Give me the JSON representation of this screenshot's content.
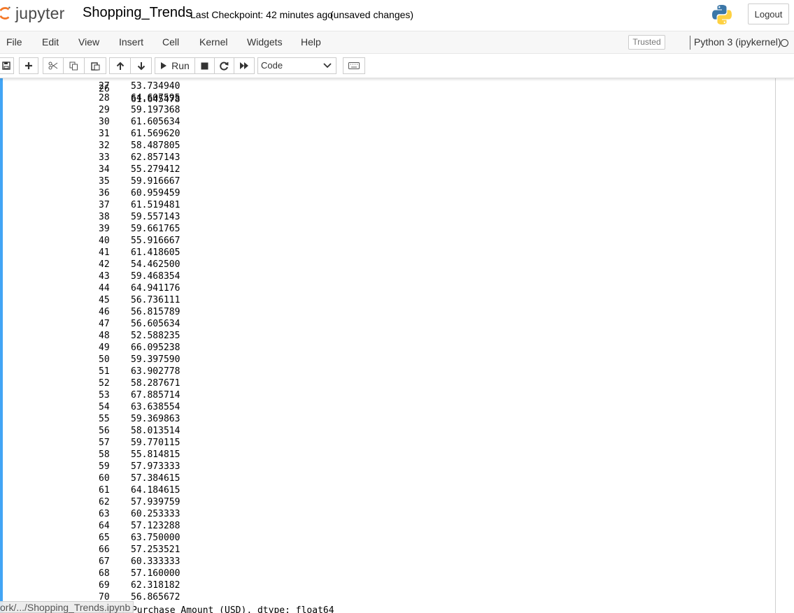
{
  "header": {
    "logo_text": "jupyter",
    "notebook_name": "Shopping_Trends",
    "checkpoint": "Last Checkpoint: 42 minutes ago",
    "autosave": "(unsaved changes)",
    "logout_label": "Logout"
  },
  "menubar": {
    "items": [
      "File",
      "Edit",
      "View",
      "Insert",
      "Cell",
      "Kernel",
      "Widgets",
      "Help"
    ],
    "trusted_label": "Trusted",
    "kernel_name": "Python 3 (ipykernel)"
  },
  "toolbar": {
    "run_label": "Run",
    "cell_type": "Code"
  },
  "output": {
    "partial_top": {
      "index": "26",
      "value": "61.645478"
    },
    "rows": [
      {
        "index": "27",
        "value": "53.734940"
      },
      {
        "index": "28",
        "value": "64.607595"
      },
      {
        "index": "29",
        "value": "59.197368"
      },
      {
        "index": "30",
        "value": "61.605634"
      },
      {
        "index": "31",
        "value": "61.569620"
      },
      {
        "index": "32",
        "value": "58.487805"
      },
      {
        "index": "33",
        "value": "62.857143"
      },
      {
        "index": "34",
        "value": "55.279412"
      },
      {
        "index": "35",
        "value": "59.916667"
      },
      {
        "index": "36",
        "value": "60.959459"
      },
      {
        "index": "37",
        "value": "61.519481"
      },
      {
        "index": "38",
        "value": "59.557143"
      },
      {
        "index": "39",
        "value": "59.661765"
      },
      {
        "index": "40",
        "value": "55.916667"
      },
      {
        "index": "41",
        "value": "61.418605"
      },
      {
        "index": "42",
        "value": "54.462500"
      },
      {
        "index": "43",
        "value": "59.468354"
      },
      {
        "index": "44",
        "value": "64.941176"
      },
      {
        "index": "45",
        "value": "56.736111"
      },
      {
        "index": "46",
        "value": "56.815789"
      },
      {
        "index": "47",
        "value": "56.605634"
      },
      {
        "index": "48",
        "value": "52.588235"
      },
      {
        "index": "49",
        "value": "66.095238"
      },
      {
        "index": "50",
        "value": "59.397590"
      },
      {
        "index": "51",
        "value": "63.902778"
      },
      {
        "index": "52",
        "value": "58.287671"
      },
      {
        "index": "53",
        "value": "67.885714"
      },
      {
        "index": "54",
        "value": "63.638554"
      },
      {
        "index": "55",
        "value": "59.369863"
      },
      {
        "index": "56",
        "value": "58.013514"
      },
      {
        "index": "57",
        "value": "59.770115"
      },
      {
        "index": "58",
        "value": "55.814815"
      },
      {
        "index": "59",
        "value": "57.973333"
      },
      {
        "index": "60",
        "value": "57.384615"
      },
      {
        "index": "61",
        "value": "64.184615"
      },
      {
        "index": "62",
        "value": "57.939759"
      },
      {
        "index": "63",
        "value": "60.253333"
      },
      {
        "index": "64",
        "value": "57.123288"
      },
      {
        "index": "65",
        "value": "63.750000"
      },
      {
        "index": "66",
        "value": "57.253521"
      },
      {
        "index": "67",
        "value": "60.333333"
      },
      {
        "index": "68",
        "value": "57.160000"
      },
      {
        "index": "69",
        "value": "62.318182"
      },
      {
        "index": "70",
        "value": "56.865672"
      }
    ],
    "dtype_line": "Name: Purchase Amount (USD), dtype: float64"
  },
  "status_path": "ork/.../Shopping_Trends.ipynb",
  "colors": {
    "cell_border": "#42a5f5",
    "logo_orange": "#f37726"
  }
}
